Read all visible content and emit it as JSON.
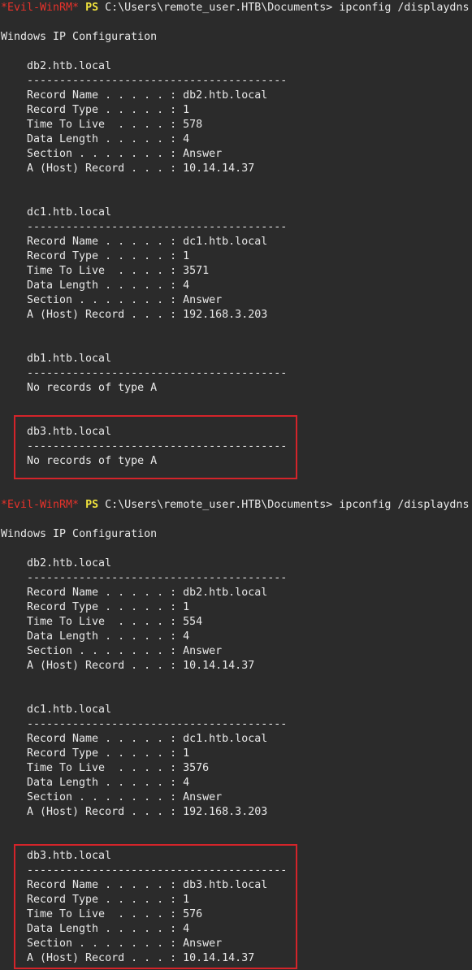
{
  "prompt": {
    "tag": "*Evil-WinRM*",
    "ps": "PS",
    "path": "C:\\Users\\remote_user.HTB\\Documents>",
    "command": "ipconfig /displaydns"
  },
  "config_header": "Windows IP Configuration",
  "separator": "----------------------------------------",
  "labels": {
    "name": "Record Name . . . . . : ",
    "type": "Record Type . . . . . : ",
    "ttl": "Time To Live  . . . . : ",
    "length": "Data Length . . . . . : ",
    "section": "Section . . . . . . . : ",
    "a_record": "A (Host) Record . . . : "
  },
  "no_records": "No records of type A",
  "run1": {
    "e1": {
      "host": "db2.htb.local",
      "name": "db2.htb.local",
      "type": "1",
      "ttl": "578",
      "length": "4",
      "section": "Answer",
      "a": "10.14.14.37"
    },
    "e2": {
      "host": "dc1.htb.local",
      "name": "dc1.htb.local",
      "type": "1",
      "ttl": "3571",
      "length": "4",
      "section": "Answer",
      "a": "192.168.3.203"
    },
    "e3": {
      "host": "db1.htb.local"
    },
    "e4": {
      "host": "db3.htb.local"
    }
  },
  "run2": {
    "e1": {
      "host": "db2.htb.local",
      "name": "db2.htb.local",
      "type": "1",
      "ttl": "554",
      "length": "4",
      "section": "Answer",
      "a": "10.14.14.37"
    },
    "e2": {
      "host": "dc1.htb.local",
      "name": "dc1.htb.local",
      "type": "1",
      "ttl": "3576",
      "length": "4",
      "section": "Answer",
      "a": "192.168.3.203"
    },
    "e3": {
      "host": "db3.htb.local",
      "name": "db3.htb.local",
      "type": "1",
      "ttl": "576",
      "length": "4",
      "section": "Answer",
      "a": "10.14.14.37"
    }
  },
  "colors": {
    "background": "#2b2b2b",
    "text": "#e8e8e8",
    "prompt_tag": "#e8322b",
    "prompt_ps": "#f0e23c",
    "highlight_border": "#d4242a"
  }
}
